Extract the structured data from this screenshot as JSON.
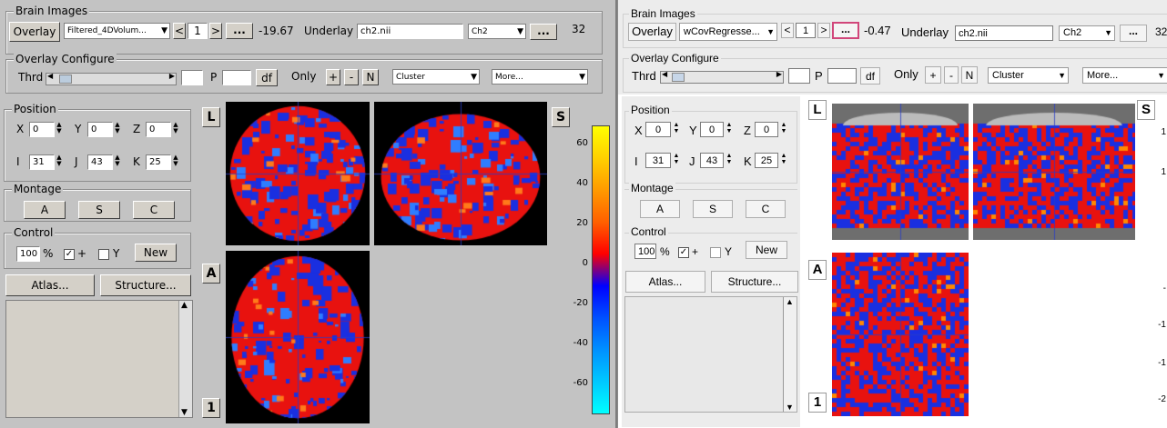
{
  "left": {
    "brain_images": {
      "legend": "Brain Images",
      "overlay_button": "Overlay",
      "overlay_file": "Filtered_4DVolum...",
      "frame": "1",
      "prev": "<",
      "next": ">",
      "dots": "...",
      "value": "-19.67",
      "underlay_label": "Underlay",
      "underlay_file": "ch2.nii",
      "underlay_select": "Ch2",
      "dots2": "...",
      "count": "32"
    },
    "overlay_config": {
      "legend": "Overlay Configure",
      "thrd": "Thrd",
      "p": "P",
      "df": "df",
      "only": "Only",
      "plus": "+",
      "minus": "-",
      "n": "N",
      "cluster": "Cluster",
      "more": "More..."
    },
    "position": {
      "legend": "Position",
      "x_label": "X",
      "x": "0",
      "y_label": "Y",
      "y": "0",
      "z_label": "Z",
      "z": "0",
      "i_label": "I",
      "i": "31",
      "j_label": "J",
      "j": "43",
      "k_label": "K",
      "k": "25"
    },
    "montage": {
      "legend": "Montage",
      "a": "A",
      "s": "S",
      "c": "C"
    },
    "control": {
      "legend": "Control",
      "pct": "100",
      "pct_sign": "%",
      "plus": "+",
      "y": "Y",
      "new": "New"
    },
    "atlas": "Atlas...",
    "structure": "Structure...",
    "view_labels": {
      "l": "L",
      "s": "S",
      "a": "A",
      "one": "1"
    },
    "colorbar_ticks": [
      "60",
      "40",
      "20",
      "0",
      "-20",
      "-40",
      "-60"
    ]
  },
  "right": {
    "brain_images": {
      "legend": "Brain Images",
      "overlay_button": "Overlay",
      "overlay_file": "wCovRegresse...",
      "frame": "1",
      "prev": "<",
      "next": ">",
      "dots": "...",
      "value": "-0.47",
      "underlay_label": "Underlay",
      "underlay_file": "ch2.nii",
      "underlay_select": "Ch2",
      "dots2": "...",
      "count": "32"
    },
    "overlay_config": {
      "legend": "Overlay Configure",
      "thrd": "Thrd",
      "p": "P",
      "df": "df",
      "only": "Only",
      "plus": "+",
      "minus": "-",
      "n": "N",
      "cluster": "Cluster",
      "more": "More..."
    },
    "position": {
      "legend": "Position",
      "x_label": "X",
      "x": "0",
      "y_label": "Y",
      "y": "0",
      "z_label": "Z",
      "z": "0",
      "i_label": "I",
      "i": "31",
      "j_label": "J",
      "j": "43",
      "k_label": "K",
      "k": "25"
    },
    "montage": {
      "legend": "Montage",
      "a": "A",
      "s": "S",
      "c": "C"
    },
    "control": {
      "legend": "Control",
      "pct": "100",
      "pct_sign": "%",
      "plus": "+",
      "y": "Y",
      "new": "New"
    },
    "atlas": "Atlas...",
    "structure": "Structure...",
    "view_labels": {
      "l": "L",
      "s": "S",
      "a": "A",
      "one": "1"
    },
    "edge_ticks": [
      "1",
      "1",
      "-",
      "-1",
      "-1",
      "-2"
    ]
  },
  "colors": {
    "overlay_red": "#e8120f",
    "overlay_blue": "#1a2fe0",
    "colorbar": [
      "#ffff00",
      "#ffd000",
      "#ff9a00",
      "#ff6000",
      "#ff0000",
      "#0000ff",
      "#0050ff",
      "#0090ff",
      "#00c8ff",
      "#00ffff"
    ]
  }
}
